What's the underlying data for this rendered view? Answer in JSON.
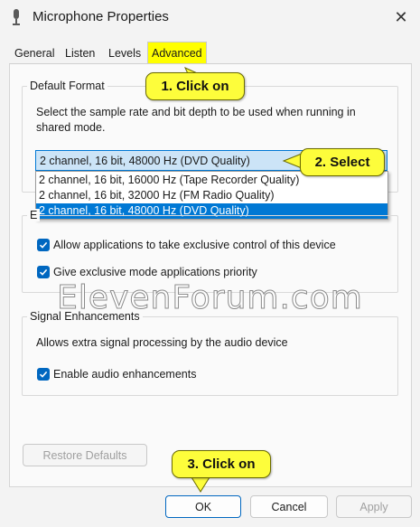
{
  "window": {
    "title": "Microphone Properties",
    "close_glyph": "✕"
  },
  "tabs": [
    {
      "label": "General"
    },
    {
      "label": "Listen"
    },
    {
      "label": "Levels"
    },
    {
      "label": "Advanced",
      "active": true
    }
  ],
  "default_format": {
    "group_label": "Default Format",
    "description": "Select the sample rate and bit depth to be used when running in shared mode.",
    "selected": "2 channel, 16 bit, 48000 Hz (DVD Quality)",
    "options": [
      "2 channel, 16 bit, 16000 Hz (Tape Recorder Quality)",
      "2 channel, 16 bit, 32000 Hz (FM Radio Quality)",
      "2 channel, 16 bit, 48000 Hz (DVD Quality)"
    ]
  },
  "exclusive_mode": {
    "group_label_fragment": "E",
    "allow_exclusive": "Allow applications to take exclusive control of this device",
    "priority": "Give exclusive mode applications priority"
  },
  "signal": {
    "group_label": "Signal Enhancements",
    "description": "Allows extra signal processing by the audio device",
    "enable": "Enable audio enhancements"
  },
  "buttons": {
    "restore": "Restore Defaults",
    "ok": "OK",
    "cancel": "Cancel",
    "apply": "Apply"
  },
  "callouts": {
    "c1": "1. Click on",
    "c2": "2. Select",
    "c3": "3. Click on"
  },
  "watermark": "ElevenForum.com",
  "colors": {
    "callout": "#fdfd3b",
    "accent": "#0078d4",
    "tab_highlight": "#ffff00"
  }
}
